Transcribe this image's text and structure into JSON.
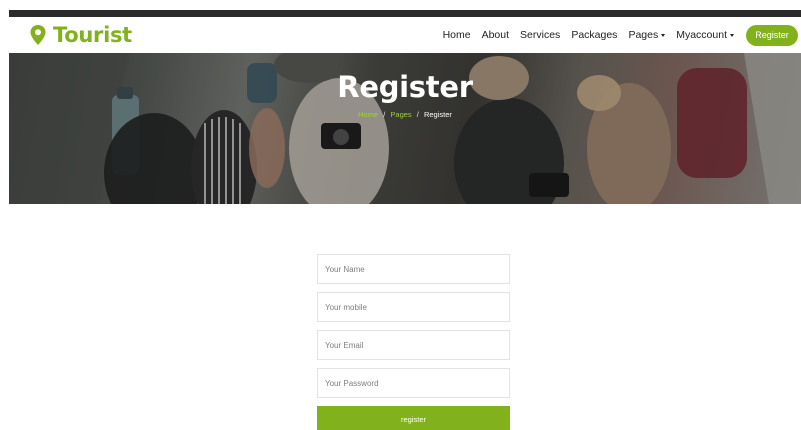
{
  "brand": {
    "name": "Tourist",
    "icon": "map-pin-icon",
    "color": "#81b21c"
  },
  "nav": {
    "items": [
      {
        "label": "Home"
      },
      {
        "label": "About"
      },
      {
        "label": "Services"
      },
      {
        "label": "Packages"
      },
      {
        "label": "Pages"
      },
      {
        "label": "Myaccount"
      }
    ],
    "cta": "Register"
  },
  "hero": {
    "title": "Register",
    "breadcrumb": {
      "home": "Home",
      "pages": "Pages",
      "current": "Register",
      "separator": "/"
    }
  },
  "form": {
    "name_placeholder": "Your Name",
    "mobile_placeholder": "Your mobile",
    "email_placeholder": "Your Email",
    "password_placeholder": "Your Password",
    "submit_label": "register"
  },
  "colors": {
    "accent": "#81b21c",
    "topbar": "#2b2b2b"
  }
}
